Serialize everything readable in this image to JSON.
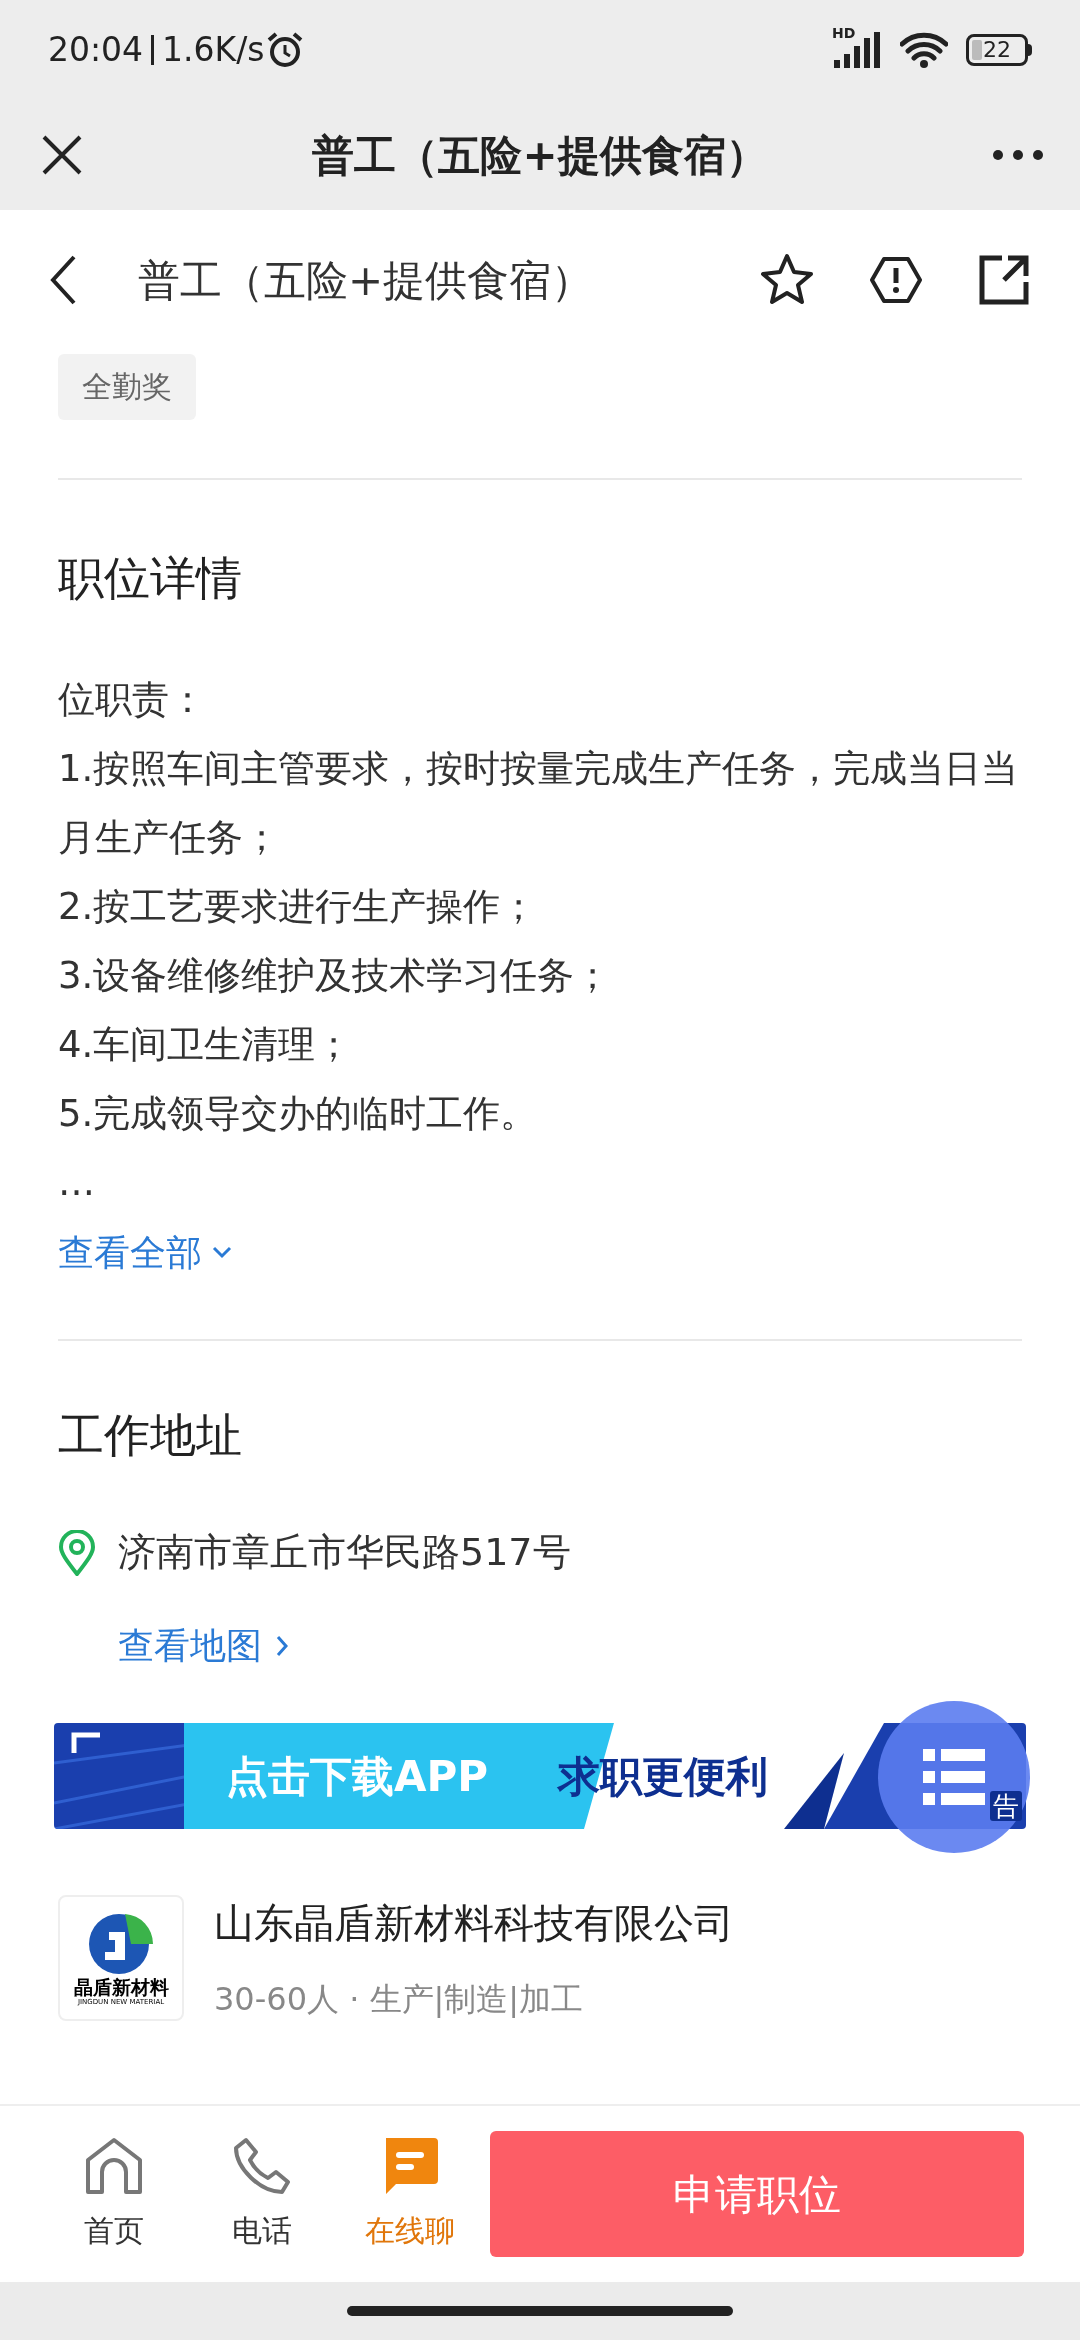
{
  "status_bar": {
    "time": "20:04",
    "speed": "1.6K/s",
    "network": "HD",
    "battery": "22"
  },
  "title_bar": {
    "title": "普工（五险+提供食宿）"
  },
  "header": {
    "title": "普工（五险+提供食宿）"
  },
  "tags": [
    "全勤奖"
  ],
  "details": {
    "heading": "职位详情",
    "lines": [
      "位职责：",
      "1.按照车间主管要求，按时按量完成生产任务，完成当日当月生产任务；",
      "2.按工艺要求进行生产操作；",
      "3.设备维修维护及技术学习任务；",
      "4.车间卫生清理；",
      "5.完成领导交办的临时工作。",
      "…"
    ],
    "more": "查看全部"
  },
  "address": {
    "heading": "工作地址",
    "text": "济南市章丘市华民路517号",
    "map_link": "查看地图"
  },
  "banner": {
    "text_left": "点击下载APP",
    "text_right": "求职更便利",
    "ad_label": "告"
  },
  "company": {
    "name": "山东晶盾新材料科技有限公司",
    "logo_text": "晶盾新材料",
    "logo_subtext": "JINGDUN NEW MATERIAL",
    "info": "30-60人 · 生产|制造|加工"
  },
  "bottom_nav": {
    "items": [
      {
        "kind": "home",
        "label": "首页",
        "selected": false
      },
      {
        "kind": "phone",
        "label": "电话",
        "selected": false
      },
      {
        "kind": "chat",
        "label": "在线聊",
        "selected": true
      }
    ],
    "apply_button": "申请职位"
  }
}
